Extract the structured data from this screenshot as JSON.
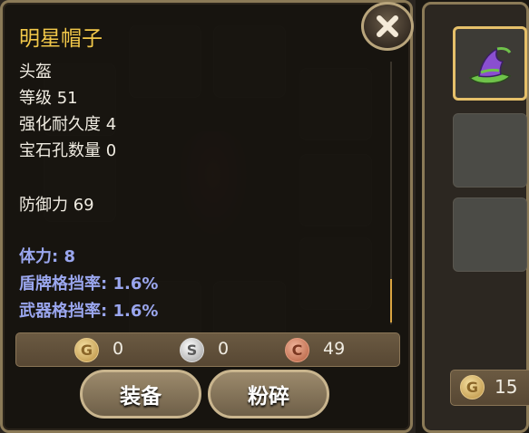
{
  "item": {
    "name": "明星帽子",
    "type": "头盔",
    "level_label": "等级 51",
    "durability_label": "强化耐久度 4",
    "gem_slots_label": "宝石孔数量 0",
    "defense_label": "防御力 69",
    "bonus_stats": [
      {
        "label": "体力: 8"
      },
      {
        "label": "盾牌格挡率: 1.6%"
      },
      {
        "label": "武器格挡率: 1.6%"
      }
    ]
  },
  "price": {
    "gold": "0",
    "silver": "0",
    "copper": "49",
    "gold_symbol": "G",
    "silver_symbol": "S",
    "copper_symbol": "C"
  },
  "buttons": {
    "equip_label": "装备",
    "smash_label": "粉碎"
  },
  "side_panel": {
    "gold": "15",
    "gold_symbol": "G"
  },
  "colors": {
    "title": "#f2c84a",
    "stat_text": "#f0ece2",
    "bonus_stat": "#9aa6ee",
    "frame": "#8b7a57",
    "selected_slot": "#e6c06a"
  },
  "icons": {
    "close": "close-icon",
    "hat": "wizard-hat-icon"
  }
}
